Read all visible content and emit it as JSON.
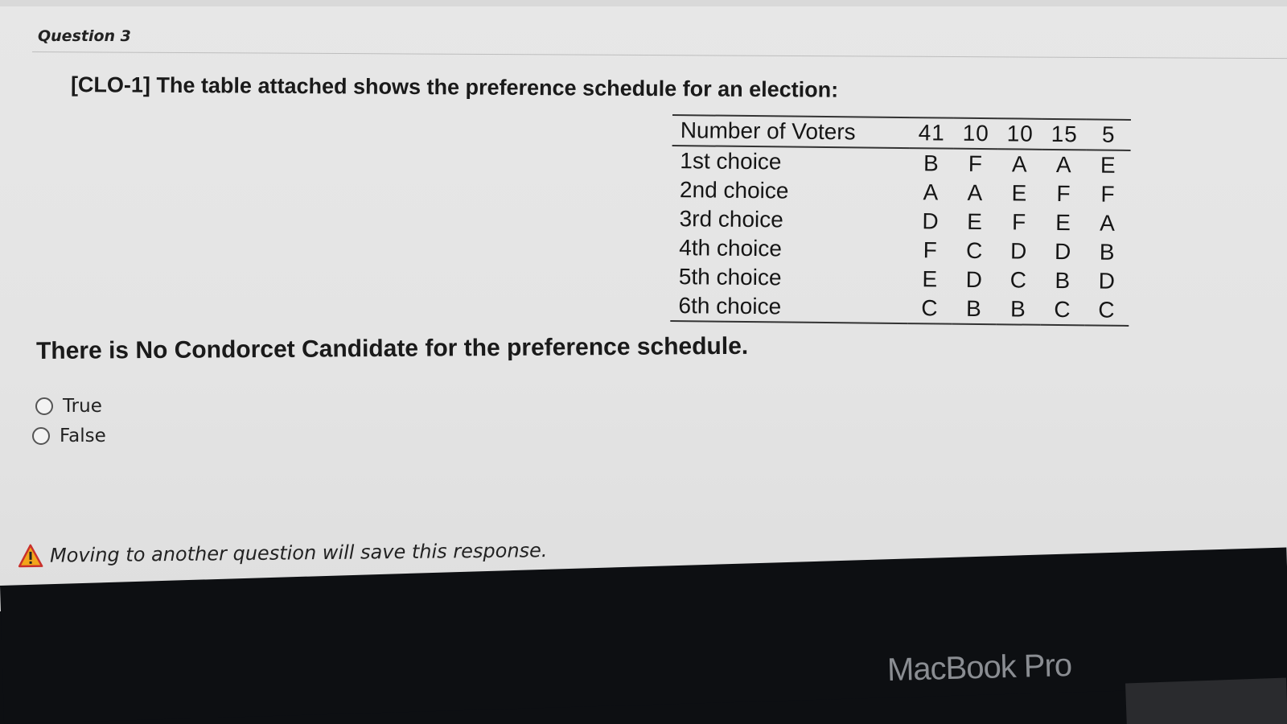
{
  "question": {
    "header": "Question 3",
    "prompt": "[CLO-1] The table attached shows the preference schedule for an election:",
    "statement": "There is No Condorcet Candidate for the preference schedule."
  },
  "table": {
    "header_label": "Number of Voters",
    "voters": [
      "41",
      "10",
      "10",
      "15",
      "5"
    ],
    "rows": [
      {
        "label": "1st choice",
        "cells": [
          "B",
          "F",
          "A",
          "A",
          "E"
        ]
      },
      {
        "label": "2nd choice",
        "cells": [
          "A",
          "A",
          "E",
          "F",
          "F"
        ]
      },
      {
        "label": "3rd choice",
        "cells": [
          "D",
          "E",
          "F",
          "E",
          "A"
        ]
      },
      {
        "label": "4th choice",
        "cells": [
          "F",
          "C",
          "D",
          "D",
          "B"
        ]
      },
      {
        "label": "5th choice",
        "cells": [
          "E",
          "D",
          "C",
          "B",
          "D"
        ]
      },
      {
        "label": "6th choice",
        "cells": [
          "C",
          "B",
          "B",
          "C",
          "C"
        ]
      }
    ]
  },
  "options": [
    {
      "label": "True"
    },
    {
      "label": "False"
    }
  ],
  "warning": {
    "text": "Moving to another question will save this response.",
    "icon": "warning-triangle-icon"
  },
  "device": {
    "label": "MacBook Pro"
  },
  "colors": {
    "warning_fill": "#f2a51a",
    "warning_stroke": "#c9302c",
    "bezel": "#0d0f12"
  }
}
